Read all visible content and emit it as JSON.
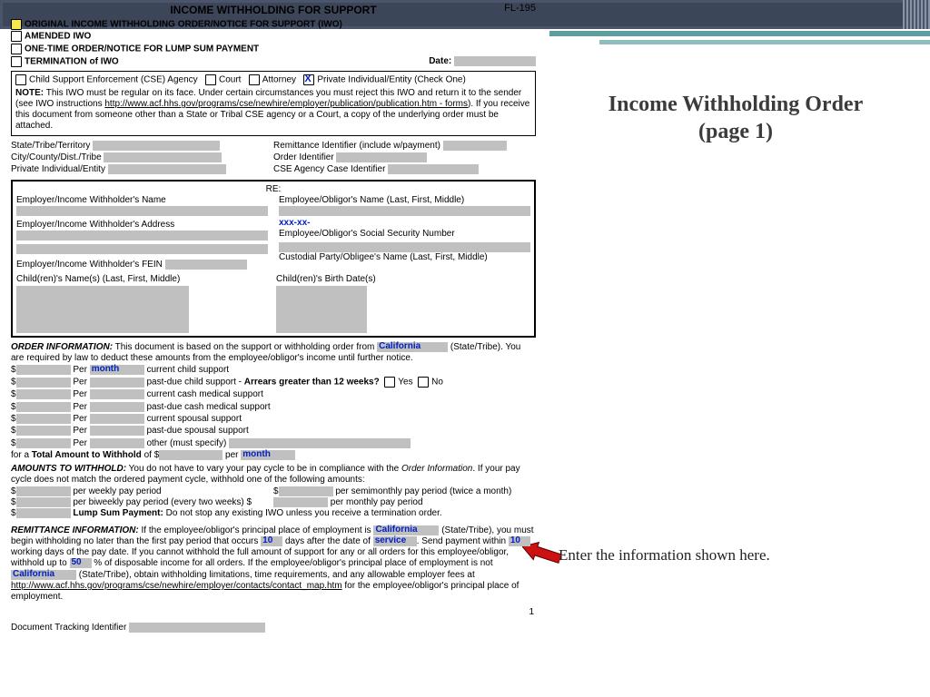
{
  "slide": {
    "title_line1": "Income Withholding Order",
    "title_line2": "(page 1)",
    "note": "Enter the information shown here."
  },
  "form": {
    "form_number": "FL-195",
    "title": "INCOME WITHHOLDING FOR SUPPORT",
    "options": {
      "original": "ORIGINAL INCOME WITHHOLDING ORDER/NOTICE FOR SUPPORT (IWO)",
      "amended": "AMENDED IWO",
      "onetime": "ONE-TIME ORDER/NOTICE FOR LUMP SUM PAYMENT",
      "termination": "TERMINATION of IWO"
    },
    "date_label": "Date:",
    "origin": {
      "cse": "Child Support Enforcement (CSE) Agency",
      "court": "Court",
      "attorney": "Attorney",
      "private": "Private Individual/Entity  (Check One)"
    },
    "note_label": "NOTE:",
    "note_text1": "This IWO must be regular on its face. Under certain circumstances you must reject this IWO and return it to the sender (see IWO instructions ",
    "note_link": "http://www.acf.hhs.gov/programs/cse/newhire/employer/publication/publication.htm - forms",
    "note_text2": "). If you receive this document from someone other than a State or Tribal CSE agency or a Court, a copy of the underlying order must be attached.",
    "ids": {
      "state": "State/Tribe/Territory",
      "city": "City/County/Dist./Tribe",
      "private": "Private Individual/Entity",
      "remit": "Remittance Identifier (include w/payment)",
      "order": "Order Identifier",
      "cse": "CSE Agency Case Identifier"
    },
    "parties": {
      "re": "RE:",
      "emp_name": "Employer/Income Withholder's Name",
      "emp_addr": "Employer/Income Withholder's Address",
      "emp_fein": "Employer/Income Withholder's FEIN",
      "obl_name": "Employee/Obligor's Name (Last, First, Middle)",
      "ssn_mask": "xxx-xx-",
      "obl_ssn": "Employee/Obligor's Social Security Number",
      "cust": "Custodial Party/Obligee's Name (Last, First, Middle)",
      "child_names": "Child(ren)'s Name(s) (Last, First, Middle)",
      "child_dob": "Child(ren)'s Birth Date(s)"
    },
    "order_info": {
      "heading": "ORDER INFORMATION:",
      "lead": " This document is based on the support or withholding order from ",
      "state_val": "California",
      "state_suffix": " (State/Tribe). You are required by law to deduct these amounts from the employee/obligor's income until further notice.",
      "per": "Per",
      "month": "month",
      "lines": {
        "l1": "current child support",
        "l2_a": "past-due child support - ",
        "l2_b": "Arrears greater than 12 weeks?",
        "yes": "Yes",
        "no": "No",
        "l3": "current cash medical support",
        "l4": "past-due cash medical support",
        "l5": "current spousal support",
        "l6": "past-due spousal support",
        "l7": "other (must specify)"
      },
      "total_a": "for a ",
      "total_b": "Total Amount to Withhold",
      "total_c": " of $",
      "total_per": " per "
    },
    "amounts": {
      "heading": "AMOUNTS TO WITHHOLD:",
      "lead": " You do not have to vary your pay cycle to be in compliance with the ",
      "oi": "Order Information",
      "lead2": ". If your pay cycle does not match the ordered payment cycle, withhold one of the following amounts:",
      "weekly": " per weekly pay period",
      "semi": " per semimonthly pay period (twice a month)",
      "biweekly": " per biweekly pay period (every two weeks) $",
      "monthly": " per monthly pay period",
      "lump_b": "Lump Sum Payment:",
      "lump_t": " Do not stop any existing IWO unless you receive a termination order."
    },
    "remit": {
      "heading": "REMITTANCE INFORMATION:",
      "t1": " If the employee/obligor's principal place of employment is ",
      "california": "California",
      "t2": " (State/Tribe), you must begin withholding no later than the first pay period that occurs ",
      "days_val": "10",
      "t3": " days after the date of ",
      "service": "service",
      "t4": ". Send payment within ",
      "wd_val": "10",
      "t5": " working days of the pay date. If you cannot withhold the full amount of support for any or all orders for this employee/obligor, withhold up to ",
      "pct_val": "50",
      "t6": " % of disposable income for all orders. If the employee/obligor's principal place of employment is not ",
      "t7": " (State/Tribe), obtain withholding limitations, time requirements, and any allowable employer fees at ",
      "link": "http://www.acf.hhs.gov/programs/cse/newhire/employer/contacts/contact_map.htm",
      "t8": " for the employee/obligor's principal place of employment."
    },
    "tracking": "Document Tracking Identifier",
    "page": "1"
  }
}
